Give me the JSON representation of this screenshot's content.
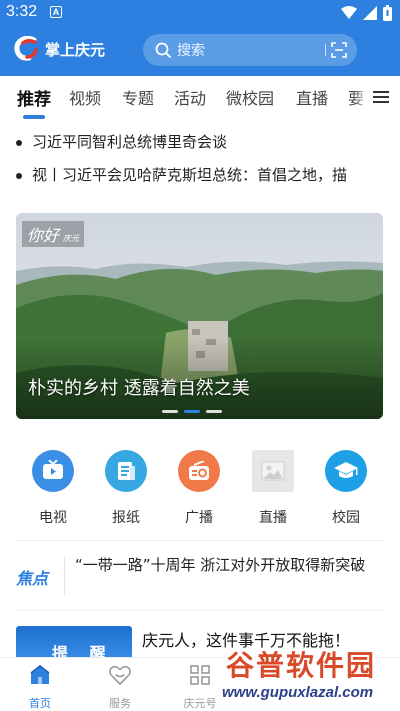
{
  "status_bar": {
    "time": "3:32",
    "notification_glyph": "A"
  },
  "app": {
    "name": "掌上庆元"
  },
  "search": {
    "placeholder": "搜索"
  },
  "tabs": [
    {
      "label": "推荐",
      "active": true
    },
    {
      "label": "视频"
    },
    {
      "label": "专题"
    },
    {
      "label": "活动"
    },
    {
      "label": "微校园"
    },
    {
      "label": "直播"
    },
    {
      "label": "要"
    }
  ],
  "headlines": [
    "习近平同智利总统博里奇会谈",
    "视丨习近平会见哈萨克斯坦总统：首倡之地，描"
  ],
  "banner": {
    "caption": "朴实的乡村 透露着自然之美",
    "overlay_tag": "你好",
    "overlay_sub": "庆元",
    "active_slide_of_3": 2
  },
  "quick_links": [
    {
      "label": "电视",
      "icon": "tv-icon",
      "color": "#3b8ee6"
    },
    {
      "label": "报纸",
      "icon": "newspaper-icon",
      "color": "#36a7e0"
    },
    {
      "label": "广播",
      "icon": "radio-icon",
      "color": "#f07a4a"
    },
    {
      "label": "直播",
      "icon": "image-placeholder-icon",
      "color": "#e2e2e2"
    },
    {
      "label": "校园",
      "icon": "graduation-cap-icon",
      "color": "#1ea0e6"
    }
  ],
  "focus": {
    "tag": "焦点",
    "text": "“一带一路”十周年 浙江对外开放取得新突破"
  },
  "news": {
    "thumb_text": "提 醒",
    "title": "庆元人，这件事千万不能拖！"
  },
  "bottom_nav": [
    {
      "label": "首页",
      "active": true
    },
    {
      "label": "服务"
    },
    {
      "label": "庆元号"
    }
  ],
  "watermark": {
    "title": "谷普软件园",
    "url": "www.gupuxlazal.com"
  },
  "colors": {
    "brand_blue": "#2e80e0"
  }
}
